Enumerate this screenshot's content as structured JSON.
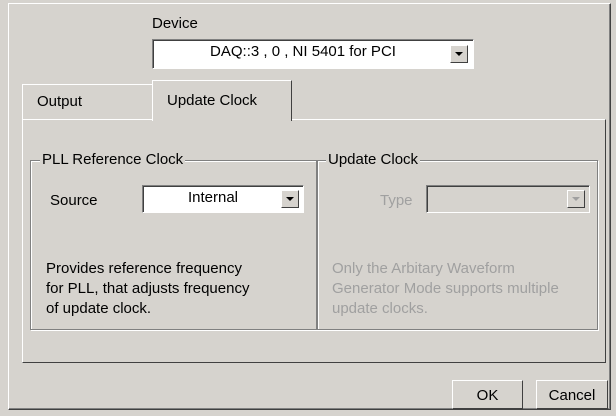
{
  "device": {
    "label": "Device",
    "value": "DAQ::3 , 0 , NI 5401 for PCI"
  },
  "tabs": [
    {
      "label": "Output",
      "selected": false
    },
    {
      "label": "Update Clock",
      "selected": true
    }
  ],
  "pll_group": {
    "title": "PLL Reference Clock",
    "source_label": "Source",
    "source_value": "Internal",
    "description": "Provides reference frequency\nfor PLL, that adjusts frequency\nof update clock."
  },
  "update_group": {
    "title": "Update Clock",
    "type_label": "Type",
    "type_value": "",
    "description": "Only the Arbitary Waveform\nGenerator Mode supports multiple\nupdate clocks."
  },
  "buttons": {
    "ok": "OK",
    "cancel": "Cancel"
  }
}
